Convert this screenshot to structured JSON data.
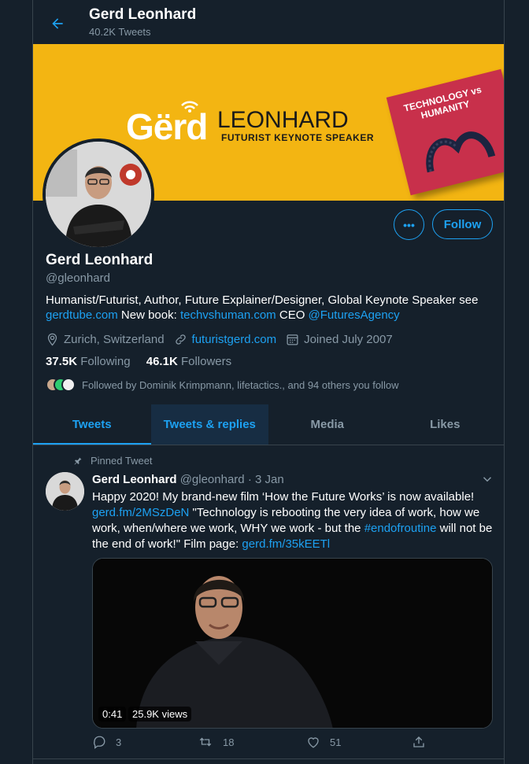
{
  "header": {
    "name": "Gerd Leonhard",
    "tweet_count": "40.2K Tweets"
  },
  "banner": {
    "logo_first": "Gërd",
    "logo_last": "LEONHARD",
    "logo_tagline": "FUTURIST KEYNOTE SPEAKER",
    "book_title": "TECHNOLOGY vs HUMANITY",
    "background_color": "#f3b512"
  },
  "actions": {
    "more_label": "•••",
    "follow_label": "Follow"
  },
  "profile": {
    "name": "Gerd Leonhard",
    "handle": "@gleonhard",
    "bio_text_1": "Humanist/Futurist, Author, Future Explainer/Designer, Global Keynote Speaker see",
    "bio_link_1": "gerdtube.com",
    "bio_text_2": " New book:",
    "bio_link_2": "techvshuman.com",
    "bio_text_3": " CEO",
    "bio_link_3": "@FuturesAgency",
    "location": "Zurich, Switzerland",
    "website": "futuristgerd.com",
    "joined": "Joined July 2007",
    "following_count": "37.5K",
    "following_label": "Following",
    "followers_count": "46.1K",
    "followers_label": "Followers",
    "followed_by": "Followed by Dominik Krimpmann, lifetactics., and 94 others you follow"
  },
  "tabs": [
    {
      "label": "Tweets"
    },
    {
      "label": "Tweets & replies"
    },
    {
      "label": "Media"
    },
    {
      "label": "Likes"
    }
  ],
  "tweet": {
    "pinned_label": "Pinned Tweet",
    "author": "Gerd Leonhard",
    "handle": "@gleonhard",
    "date": "· 3 Jan",
    "text_1": "Happy 2020! My brand-new film ‘How the Future Works’ is now available!",
    "link_1": "gerd.fm/2MSzDeN",
    "text_2": " \"Technology is rebooting the very idea of work, how we work, when/where we work, WHY we work - but the",
    "hashtag": "#endofroutine",
    "text_3": " will not be the end of work!\" Film page:",
    "link_2": "gerd.fm/35kEETl",
    "video_duration": "0:41",
    "video_views": "25.9K views",
    "replies": "3",
    "retweets": "18",
    "likes": "51"
  },
  "colors": {
    "accent": "#1da1f2",
    "background": "#15202b",
    "secondary_text": "#8899a6",
    "border": "#38444d"
  }
}
